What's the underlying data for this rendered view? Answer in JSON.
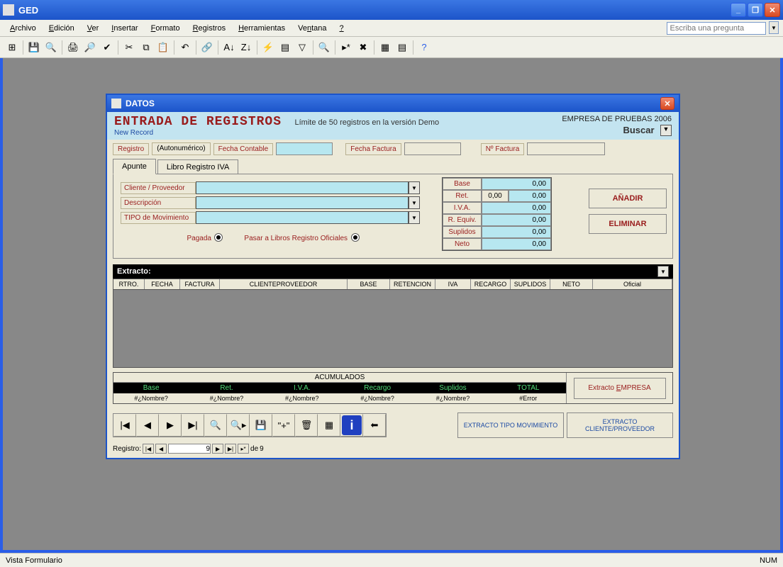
{
  "app": {
    "title": "GED"
  },
  "menu": {
    "items": [
      "Archivo",
      "Edición",
      "Ver",
      "Insertar",
      "Formato",
      "Registros",
      "Herramientas",
      "Ventana",
      "?"
    ],
    "help_placeholder": "Escriba una pregunta"
  },
  "datos": {
    "window_title": "DATOS",
    "header_title": "ENTRADA DE REGISTROS",
    "header_sub": "New Record",
    "demo_note": "Límite de 50 registros en la versión Demo",
    "empresa": "EMPRESA DE PRUEBAS 2006",
    "buscar": "Buscar",
    "reg_row": {
      "registro": "Registro",
      "autonum": "(Autonumérico)",
      "fecha_contable": "Fecha Contable",
      "fecha_factura": "Fecha Factura",
      "n_factura": "Nº Factura"
    },
    "tabs": {
      "apunte": "Apunte",
      "libro": "Libro Registro IVA"
    },
    "form": {
      "cliente": "Cliente / Proveedor",
      "descripcion": "Descripción",
      "tipo_mov": "TIPO de Movimiento",
      "pagada": "Pagada",
      "pasar": "Pasar a Libros Registro Oficiales"
    },
    "amounts": {
      "base": "Base",
      "base_v": "0,00",
      "ret": "Ret.",
      "ret_pct": "0,00",
      "ret_v": "0,00",
      "iva": "I.V.A.",
      "iva_v": "0,00",
      "requiv": "R. Equiv.",
      "requiv_v": "0,00",
      "suplidos": "Suplidos",
      "suplidos_v": "0,00",
      "neto": "Neto",
      "neto_v": "0,00"
    },
    "buttons": {
      "anadir": "AÑADIR",
      "eliminar": "ELIMINAR"
    },
    "extracto": {
      "title": "Extracto:",
      "cols": [
        "RTRO.",
        "FECHA",
        "FACTURA",
        "CLIENTEPROVEEDOR",
        "BASE",
        "RETENCION",
        "IVA",
        "RECARGO",
        "SUPLIDOS",
        "NETO",
        "Oficial"
      ]
    },
    "acumulados": {
      "title": "ACUMULADOS",
      "cols": [
        "Base",
        "Ret.",
        "I.V.A.",
        "Recargo",
        "Suplidos",
        "TOTAL"
      ],
      "vals": [
        "#¿Nombre?",
        "#¿Nombre?",
        "#¿Nombre?",
        "#¿Nombre?",
        "#¿Nombre?",
        "#Error"
      ],
      "empresa_btn": "Extracto EMPRESA"
    },
    "bottom": {
      "extracto_tipo": "EXTRACTO TIPO MOVIMIENTO",
      "extracto_cliente": "EXTRACTO CLIENTE/PROVEEDOR"
    },
    "recnav": {
      "label": "Registro:",
      "current": "9",
      "of": "de",
      "total": "9"
    }
  },
  "statusbar": {
    "left": "Vista Formulario",
    "right": "NUM"
  }
}
